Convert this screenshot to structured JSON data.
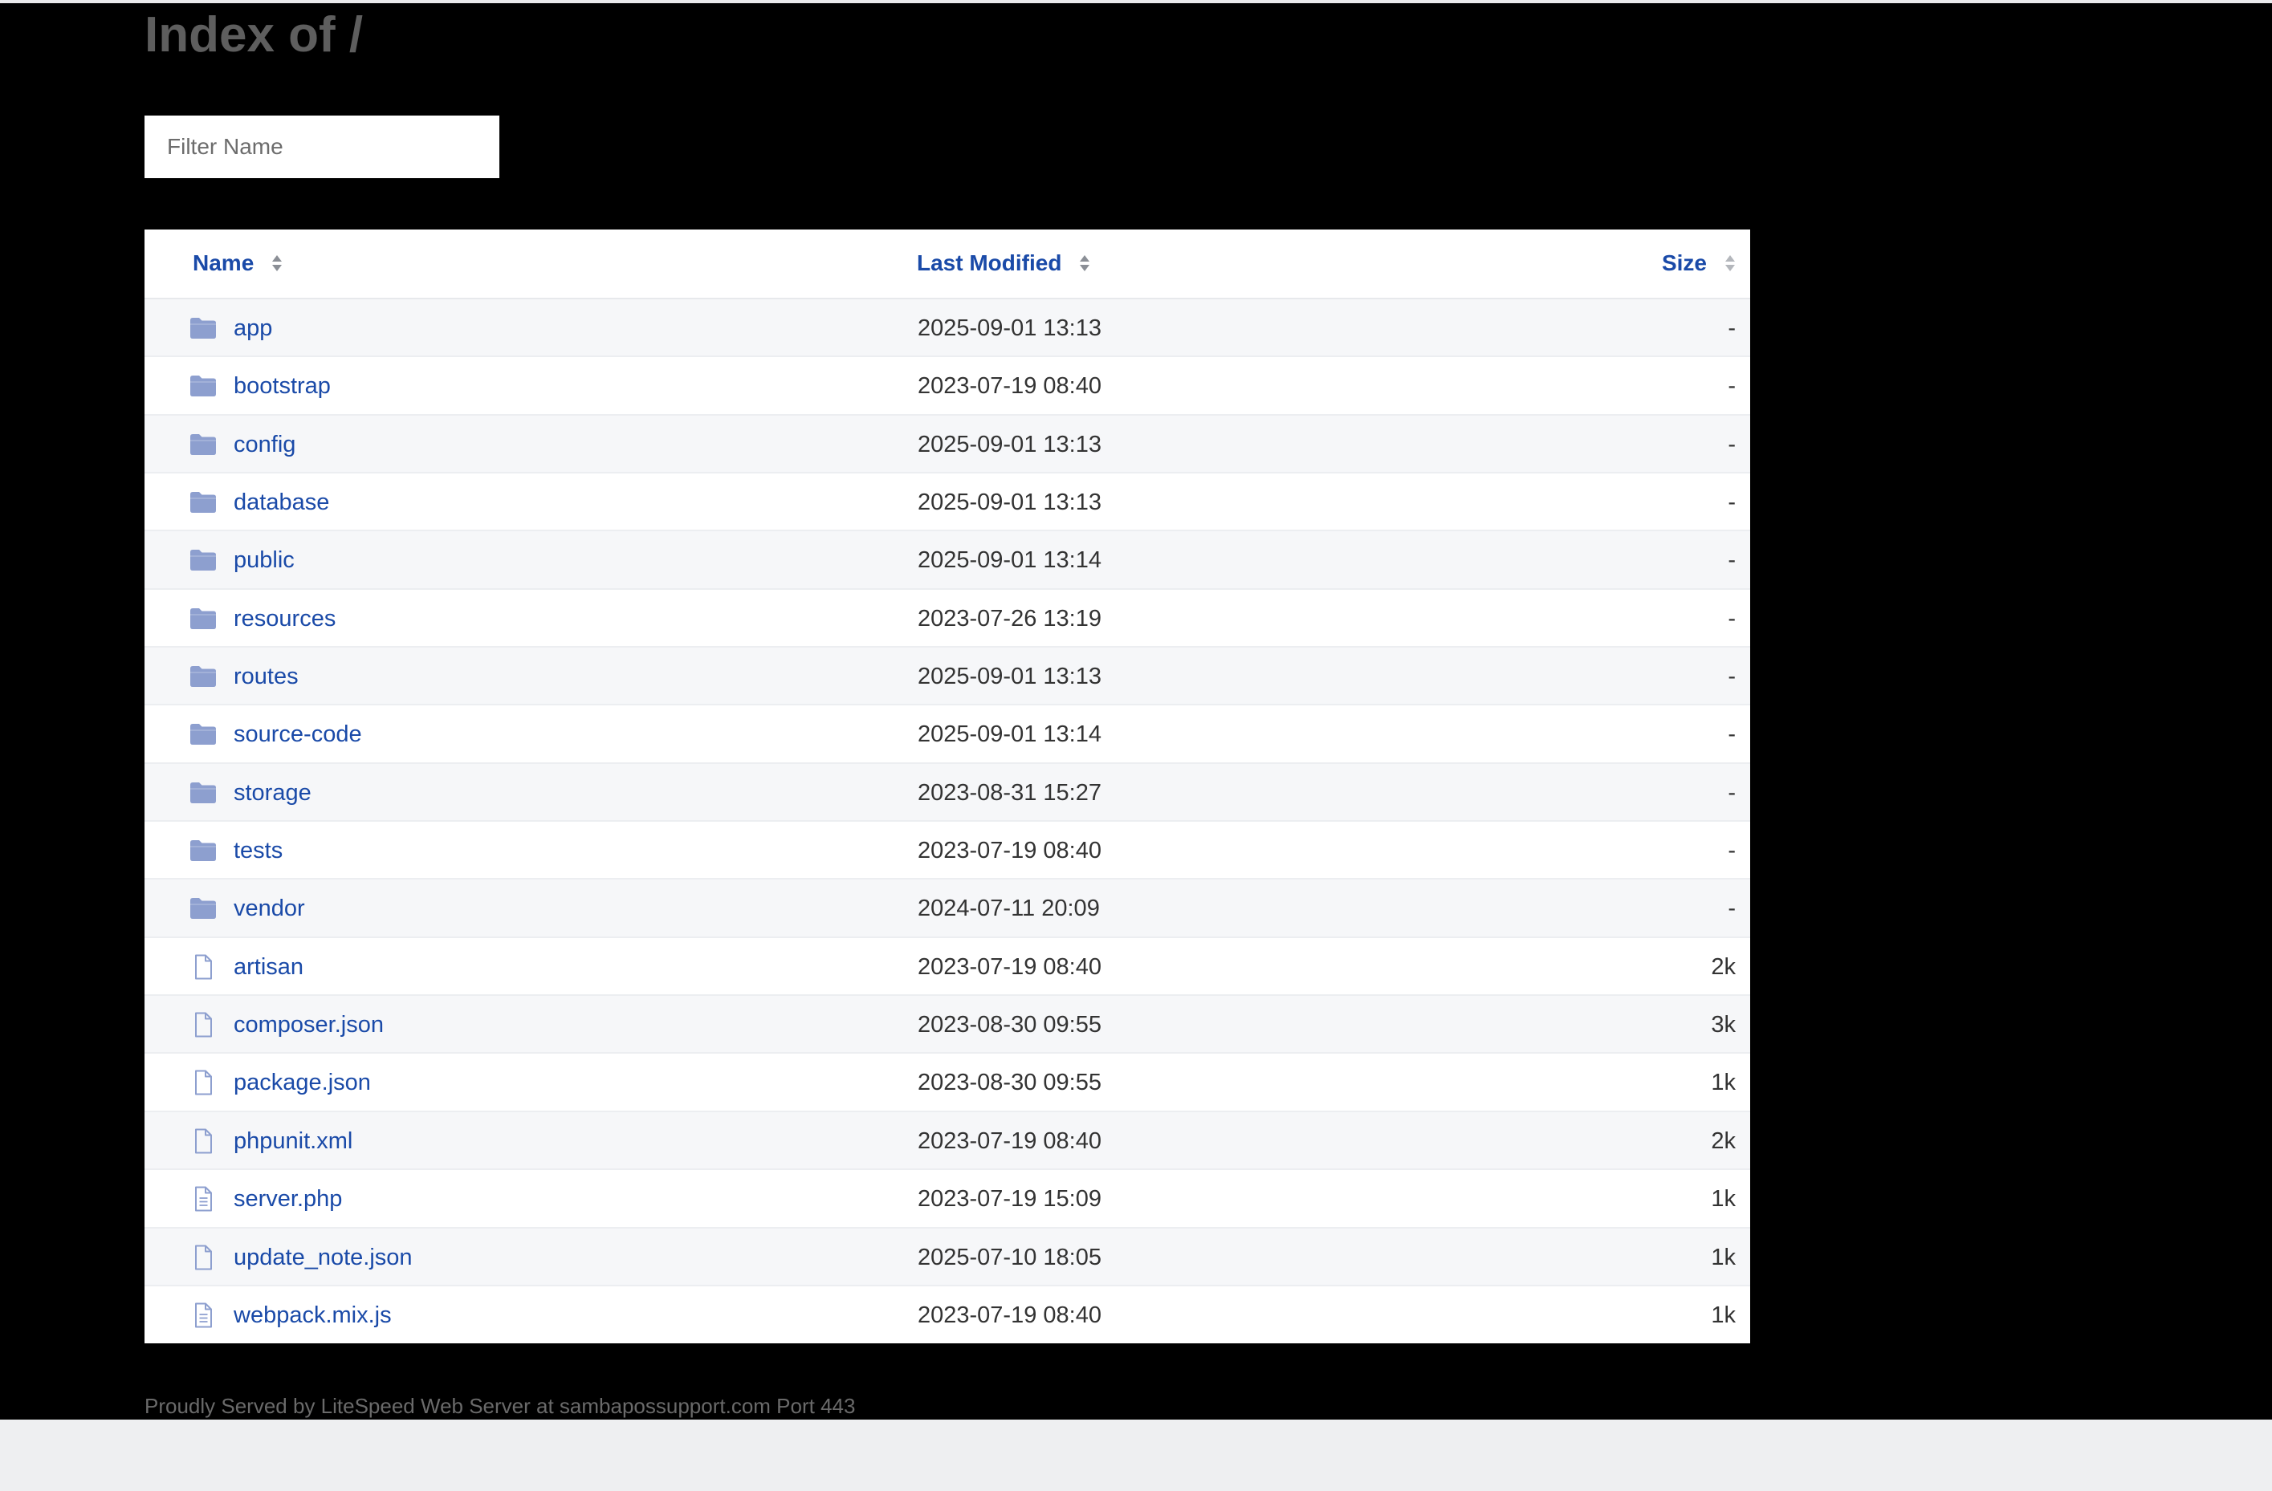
{
  "page": {
    "title": "Index of /",
    "footer": "Proudly Served by LiteSpeed Web Server at sambapossupport.com Port 443"
  },
  "filter": {
    "placeholder": "Filter Name",
    "value": ""
  },
  "table": {
    "headers": {
      "name": "Name",
      "last_modified": "Last Modified",
      "size": "Size"
    },
    "rows": [
      {
        "name": "app",
        "modified": "2025-09-01 13:13",
        "size": "-",
        "icon": "folder-icon"
      },
      {
        "name": "bootstrap",
        "modified": "2023-07-19 08:40",
        "size": "-",
        "icon": "folder-icon"
      },
      {
        "name": "config",
        "modified": "2025-09-01 13:13",
        "size": "-",
        "icon": "folder-icon"
      },
      {
        "name": "database",
        "modified": "2025-09-01 13:13",
        "size": "-",
        "icon": "folder-icon"
      },
      {
        "name": "public",
        "modified": "2025-09-01 13:14",
        "size": "-",
        "icon": "folder-icon"
      },
      {
        "name": "resources",
        "modified": "2023-07-26 13:19",
        "size": "-",
        "icon": "folder-icon"
      },
      {
        "name": "routes",
        "modified": "2025-09-01 13:13",
        "size": "-",
        "icon": "folder-icon"
      },
      {
        "name": "source-code",
        "modified": "2025-09-01 13:14",
        "size": "-",
        "icon": "folder-icon"
      },
      {
        "name": "storage",
        "modified": "2023-08-31 15:27",
        "size": "-",
        "icon": "folder-icon"
      },
      {
        "name": "tests",
        "modified": "2023-07-19 08:40",
        "size": "-",
        "icon": "folder-icon"
      },
      {
        "name": "vendor",
        "modified": "2024-07-11 20:09",
        "size": "-",
        "icon": "folder-icon"
      },
      {
        "name": "artisan",
        "modified": "2023-07-19 08:40",
        "size": "2k",
        "icon": "file-icon"
      },
      {
        "name": "composer.json",
        "modified": "2023-08-30 09:55",
        "size": "3k",
        "icon": "file-icon"
      },
      {
        "name": "package.json",
        "modified": "2023-08-30 09:55",
        "size": "1k",
        "icon": "file-icon"
      },
      {
        "name": "phpunit.xml",
        "modified": "2023-07-19 08:40",
        "size": "2k",
        "icon": "file-icon"
      },
      {
        "name": "server.php",
        "modified": "2023-07-19 15:09",
        "size": "1k",
        "icon": "text-file-icon"
      },
      {
        "name": "update_note.json",
        "modified": "2025-07-10 18:05",
        "size": "1k",
        "icon": "file-icon"
      },
      {
        "name": "webpack.mix.js",
        "modified": "2023-07-19 08:40",
        "size": "1k",
        "icon": "text-file-icon"
      }
    ]
  },
  "colors": {
    "link": "#1a4aa8",
    "icon": "#8d9fcf",
    "background": "#000000"
  }
}
